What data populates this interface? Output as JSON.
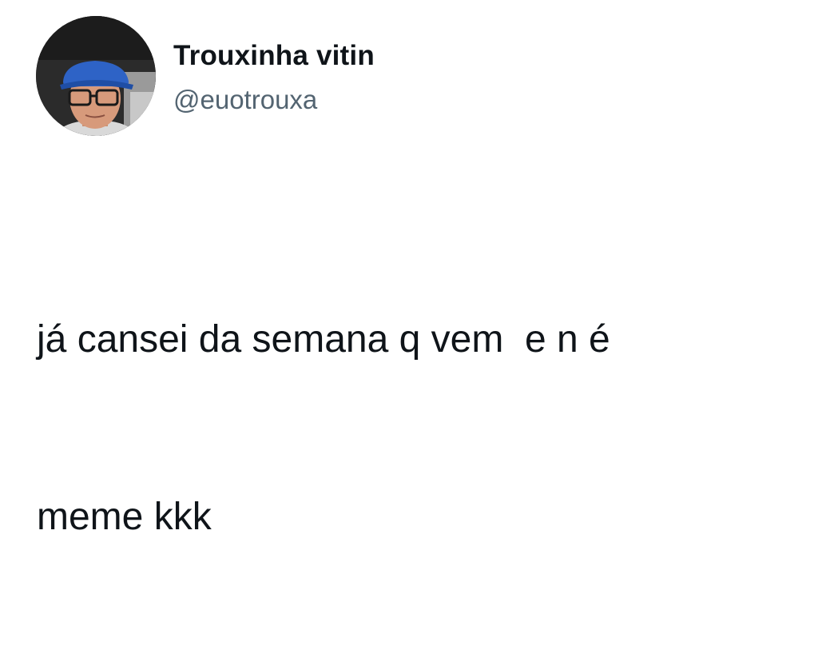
{
  "tweet": {
    "display_name": "Trouxinha vitin",
    "handle": "@euotrouxa",
    "avatar_icon": "user-avatar-photo",
    "text_line_1": "já cansei da semana q vem  e n é",
    "text_line_2": "meme kkk"
  },
  "colors": {
    "background": "#ffffff",
    "name": "#0f1419",
    "handle": "#536471",
    "cap": "#2e63c6"
  }
}
